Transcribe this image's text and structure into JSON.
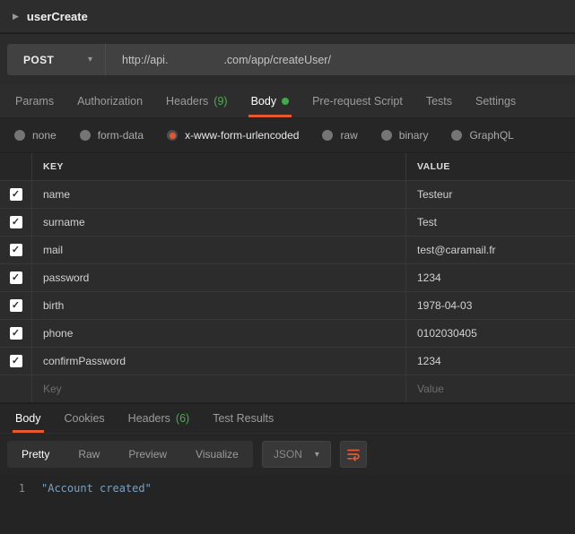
{
  "header": {
    "request_name": "userCreate"
  },
  "request": {
    "method": "POST",
    "url_part1": "http://api.",
    "url_part2": ".com/app/createUser/"
  },
  "request_tabs": [
    {
      "label": "Params"
    },
    {
      "label": "Authorization"
    },
    {
      "label": "Headers",
      "count": "(9)"
    },
    {
      "label": "Body"
    },
    {
      "label": "Pre-request Script"
    },
    {
      "label": "Tests"
    },
    {
      "label": "Settings"
    }
  ],
  "body_types": [
    {
      "label": "none",
      "selected": false
    },
    {
      "label": "form-data",
      "selected": false
    },
    {
      "label": "x-www-form-urlencoded",
      "selected": true
    },
    {
      "label": "raw",
      "selected": false
    },
    {
      "label": "binary",
      "selected": false
    },
    {
      "label": "GraphQL",
      "selected": false
    }
  ],
  "body_table": {
    "columns": {
      "key": "KEY",
      "value": "VALUE"
    },
    "rows": [
      {
        "key": "name",
        "value": "Testeur",
        "checked": true
      },
      {
        "key": "surname",
        "value": "Test",
        "checked": true
      },
      {
        "key": "mail",
        "value": "test@caramail.fr",
        "checked": true
      },
      {
        "key": "password",
        "value": "1234",
        "checked": true
      },
      {
        "key": "birth",
        "value": "1978-04-03",
        "checked": true
      },
      {
        "key": "phone",
        "value": "0102030405",
        "checked": true
      },
      {
        "key": "confirmPassword",
        "value": "1234",
        "checked": true
      }
    ],
    "placeholder_row": {
      "key": "Key",
      "value": "Value"
    }
  },
  "response": {
    "tabs": [
      {
        "label": "Body"
      },
      {
        "label": "Cookies"
      },
      {
        "label": "Headers",
        "count": "(6)"
      },
      {
        "label": "Test Results"
      }
    ],
    "toolbar": {
      "views": [
        "Pretty",
        "Raw",
        "Preview",
        "Visualize"
      ],
      "format": "JSON"
    },
    "body": {
      "line_number": "1",
      "line_content": "\"Account created\""
    }
  },
  "icons": {
    "collapse_arrow": "▶",
    "caret_down": "▾",
    "checkbox_check": "✓"
  },
  "colors": {
    "accent_orange": "#e8582e",
    "success_green": "#4cad50",
    "code_string_blue": "#7ca0be"
  }
}
